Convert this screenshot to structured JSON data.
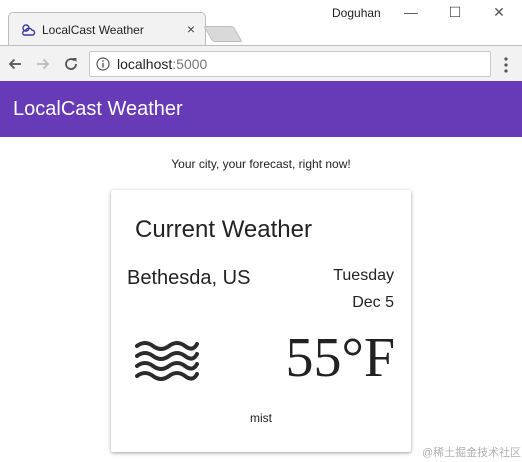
{
  "browser": {
    "tab": {
      "title": "LocalCast Weather",
      "close_label": "×"
    },
    "profile_name": "Doguhan",
    "window_controls": {
      "minimize": "—",
      "maximize": "☐",
      "close": "✕"
    },
    "address_bar": {
      "host": "localhost",
      "port": ":5000"
    },
    "icons": {
      "favicon": "weather-cloud-icon",
      "back": "arrow-left-icon",
      "forward": "arrow-right-icon",
      "reload": "reload-icon",
      "info": "info-icon",
      "menu": "vertical-dots-icon"
    }
  },
  "app": {
    "title": "LocalCast Weather",
    "tagline": "Your city, your forecast, right now!",
    "accent_color": "#673ab7"
  },
  "current_weather": {
    "heading": "Current Weather",
    "city": "Bethesda, US",
    "day": "Tuesday",
    "date": "Dec 5",
    "temperature": "55°F",
    "description": "mist",
    "icon": "mist-waves-icon"
  },
  "watermark": "@稀土掘金技术社区"
}
